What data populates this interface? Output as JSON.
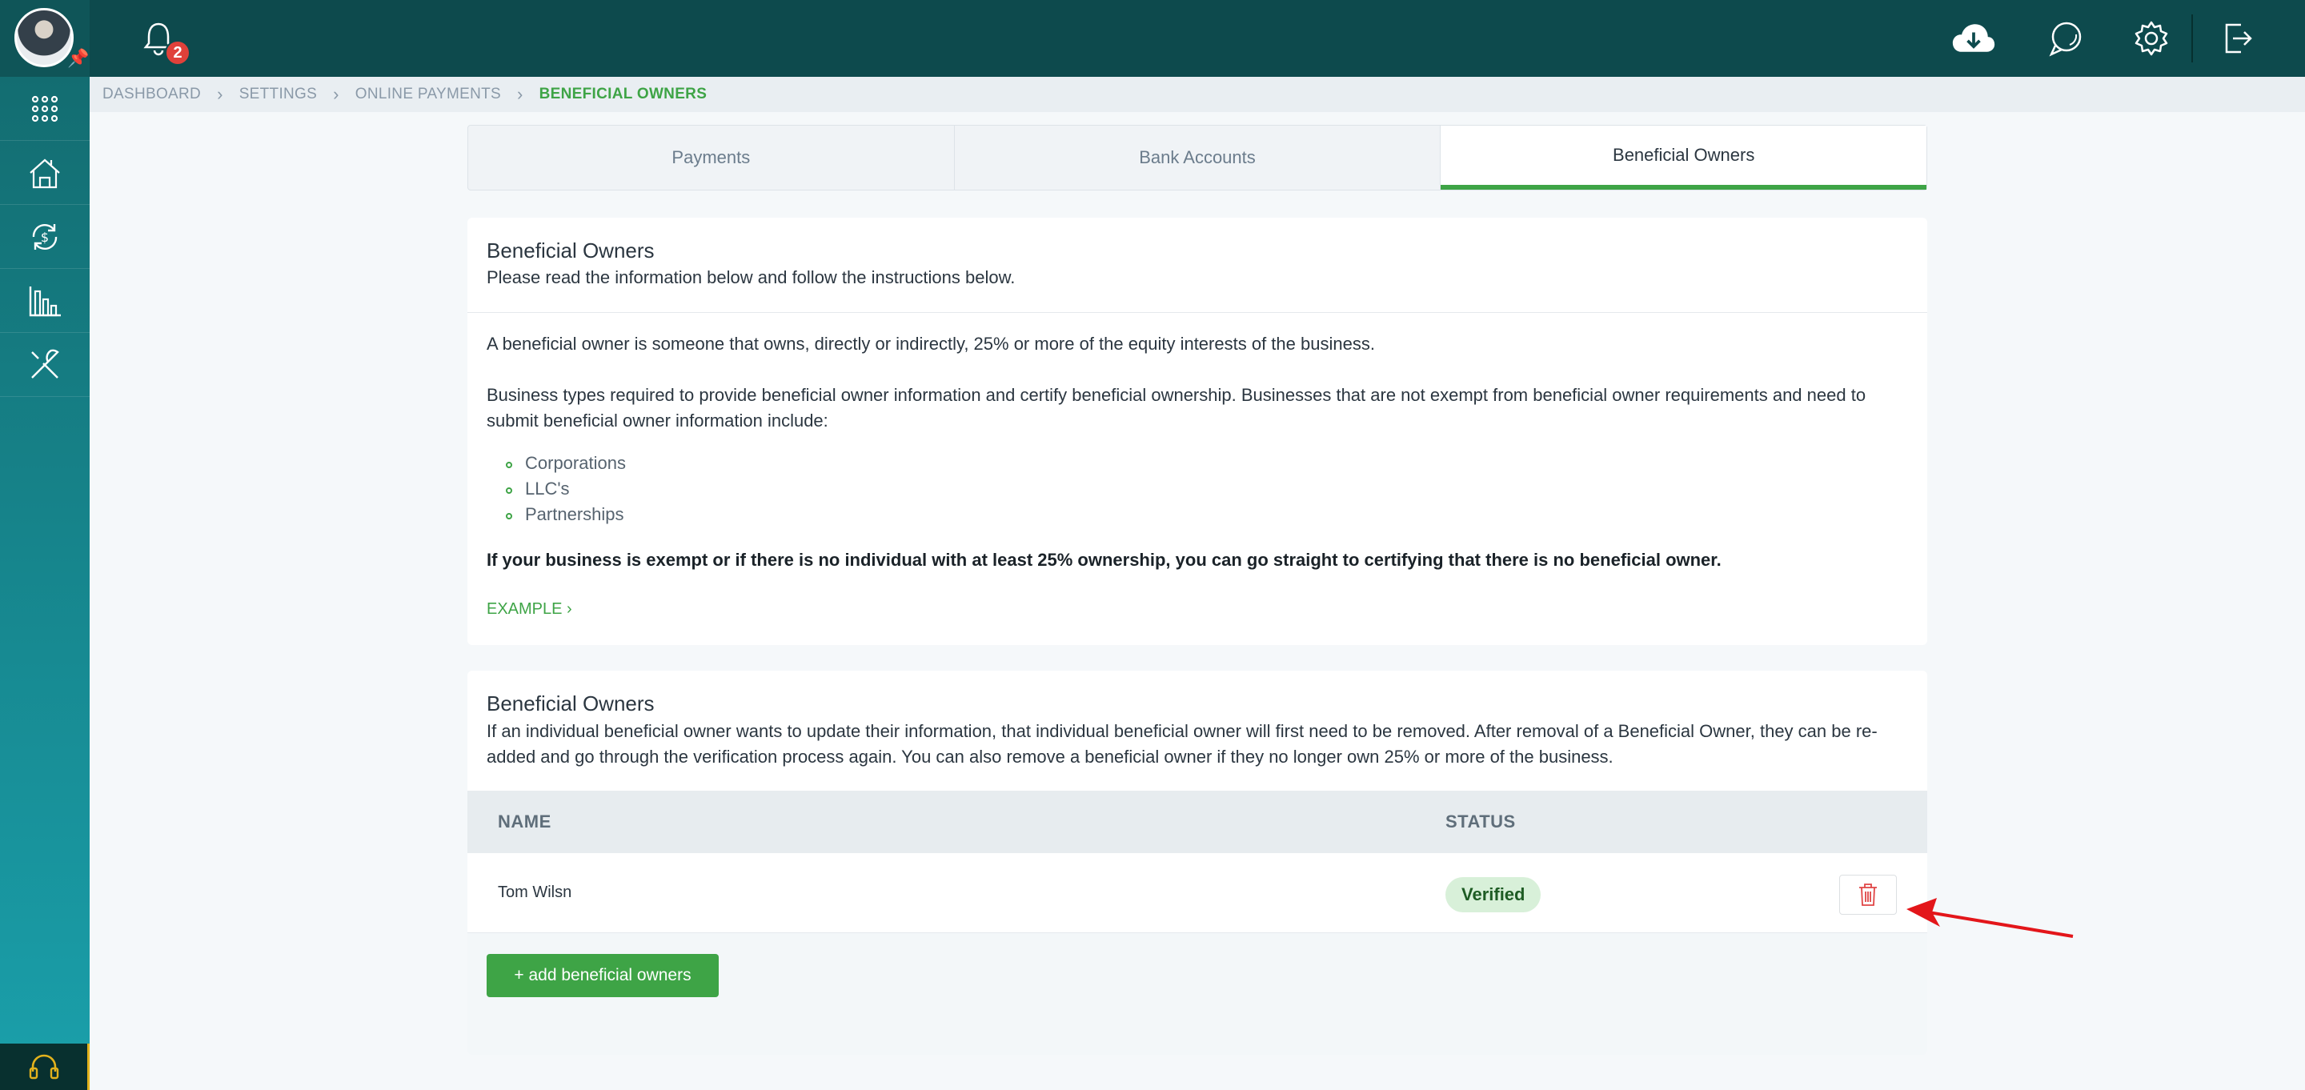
{
  "header": {
    "notification_count": "2",
    "icons": [
      "cloud-download-icon",
      "chat-icon",
      "gear-icon",
      "logout-icon"
    ]
  },
  "sidebar": {
    "items": [
      "apps-grid-icon",
      "property-icon",
      "payments-cycle-icon",
      "reports-chart-icon",
      "tools-icon"
    ],
    "support_icon": "headset-icon"
  },
  "breadcrumb": {
    "items": [
      "DASHBOARD",
      "SETTINGS",
      "ONLINE PAYMENTS",
      "BENEFICIAL OWNERS"
    ]
  },
  "tabs": [
    {
      "label": "Payments",
      "active": false
    },
    {
      "label": "Bank Accounts",
      "active": false
    },
    {
      "label": "Beneficial Owners",
      "active": true
    }
  ],
  "info_card": {
    "title": "Beneficial Owners",
    "subtitle": "Please read the information below and follow the instructions below.",
    "para1": "A beneficial owner is someone that owns, directly or indirectly, 25% or more of the equity interests of the business.",
    "para2": "Business types required to provide beneficial owner information and certify beneficial ownership. Businesses that are not exempt from beneficial owner requirements and need to submit beneficial owner information include:",
    "business_types": [
      "Corporations",
      "LLC's",
      "Partnerships"
    ],
    "note": "If your business is exempt or if there is no individual with at least 25% ownership, you can go straight to certifying that there is no beneficial owner.",
    "example_link": "EXAMPLE"
  },
  "owners_card": {
    "title": "Beneficial Owners",
    "description": "If an individual beneficial owner wants to update their information, that individual beneficial owner will first need to be removed. After removal of a Beneficial Owner, they can be re-added and go through the verification process again. You can also remove a beneficial owner if they no longer own 25% or more of the business.",
    "columns": [
      "NAME",
      "STATUS"
    ],
    "rows": [
      {
        "name": "Tom Wilsn",
        "status": "Verified"
      }
    ],
    "add_button": "+ add beneficial owners"
  },
  "colors": {
    "header": "#0d4a4d",
    "accent_green": "#3ea446",
    "annotation_arrow": "#e3161a"
  }
}
